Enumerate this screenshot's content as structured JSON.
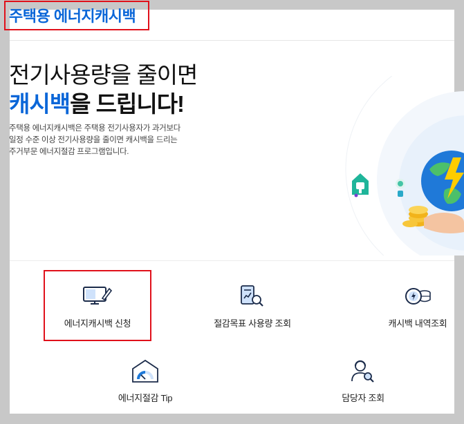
{
  "header": {
    "logo_text": "주택용 에너지캐시백"
  },
  "hero": {
    "title_line1": "전기사용량을 줄이면",
    "title_accent": "캐시백",
    "title_line2_rest": "을 드립니다!",
    "description": [
      "주택용 에너지캐시백은 주택용 전기사용자가 과거보다",
      "일정 수준 이상 전기사용량을 줄이면 캐시백을 드리는",
      "주거부문 에너지절감 프로그램입니다."
    ]
  },
  "menu": {
    "items": [
      {
        "label": "에너지캐시백 신청",
        "icon": "monitor-pen-icon"
      },
      {
        "label": "절감목표 사용량 조회",
        "icon": "document-search-icon"
      },
      {
        "label": "캐시백 내역조회",
        "icon": "coin-energy-icon"
      },
      {
        "label": "에너지절감 Tip",
        "icon": "house-gauge-icon"
      },
      {
        "label": "담당자 조회",
        "icon": "person-search-icon"
      }
    ]
  },
  "colors": {
    "accent": "#0a66d8",
    "highlight": "#e0101a",
    "text": "#111111",
    "backdrop": "#c8c8c8"
  }
}
